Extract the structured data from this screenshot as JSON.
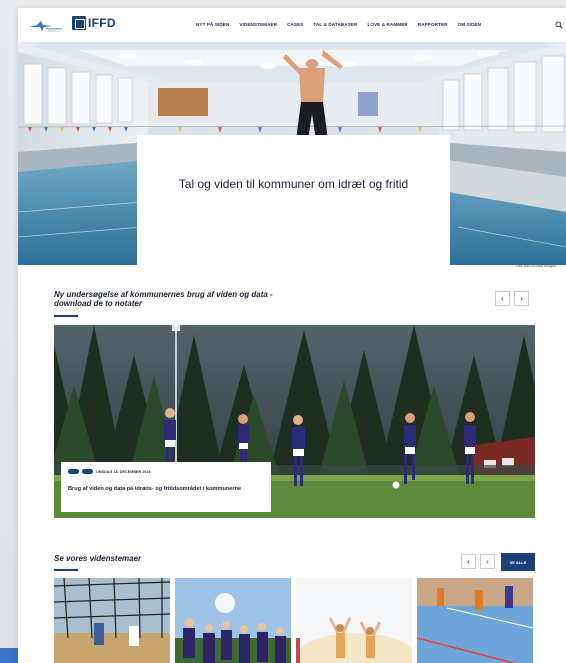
{
  "header": {
    "logo_text": "IFFD",
    "nav": [
      "NYT PÅ SIDEN",
      "VIDENSTEMAER",
      "CASES",
      "TAL & DATABASER",
      "LOVE & RAMMER",
      "RAPPORTER",
      "OM SIDEN"
    ]
  },
  "hero": {
    "title": "Tal og viden til kommuner om idræt og fritid",
    "credit": "Lars Baron/Getty Images"
  },
  "section1": {
    "title": "Ny undersøgelse af kommunernes brug af viden og data - download de to notater",
    "prev": "‹",
    "next": "›",
    "card": {
      "date": "ONSDAG 18. DECEMBER 2024",
      "title": "Brug af viden og data på idræts- og fritidsområdet i kommunerne"
    }
  },
  "section2": {
    "title": "Se vores videnstemaer",
    "prev": "‹",
    "next": "›",
    "see_all": "SE ALLE"
  },
  "colors": {
    "brand": "#1d3f7a",
    "text": "#1d2333"
  }
}
